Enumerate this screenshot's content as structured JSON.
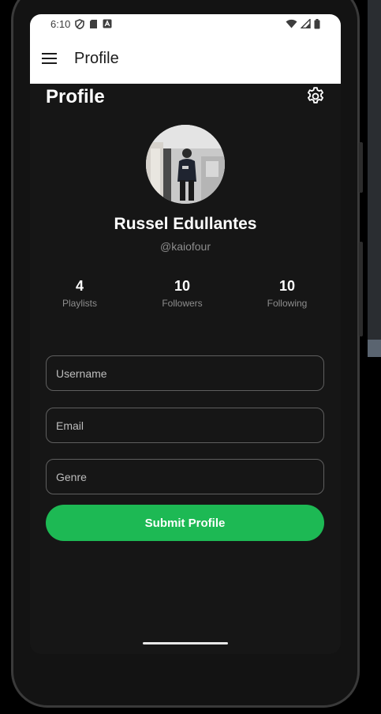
{
  "status_bar": {
    "time": "6:10",
    "icons": [
      "shield-icon",
      "sd-card-icon",
      "a-icon",
      "wifi-icon",
      "signal-icon",
      "battery-icon"
    ]
  },
  "app_bar": {
    "title": "Profile",
    "menu_icon": "hamburger-menu-icon"
  },
  "profile": {
    "heading": "Profile",
    "settings_icon": "gear-icon",
    "name": "Russel Edullantes",
    "handle": "@kaiofour"
  },
  "stats": [
    {
      "value": "4",
      "label": "Playlists"
    },
    {
      "value": "10",
      "label": "Followers"
    },
    {
      "value": "10",
      "label": "Following"
    }
  ],
  "form": {
    "username_placeholder": "Username",
    "email_placeholder": "Email",
    "genre_placeholder": "Genre",
    "submit_label": "Submit Profile"
  },
  "colors": {
    "accent": "#1db954",
    "background": "#161616",
    "app_bar": "#ffffff"
  }
}
